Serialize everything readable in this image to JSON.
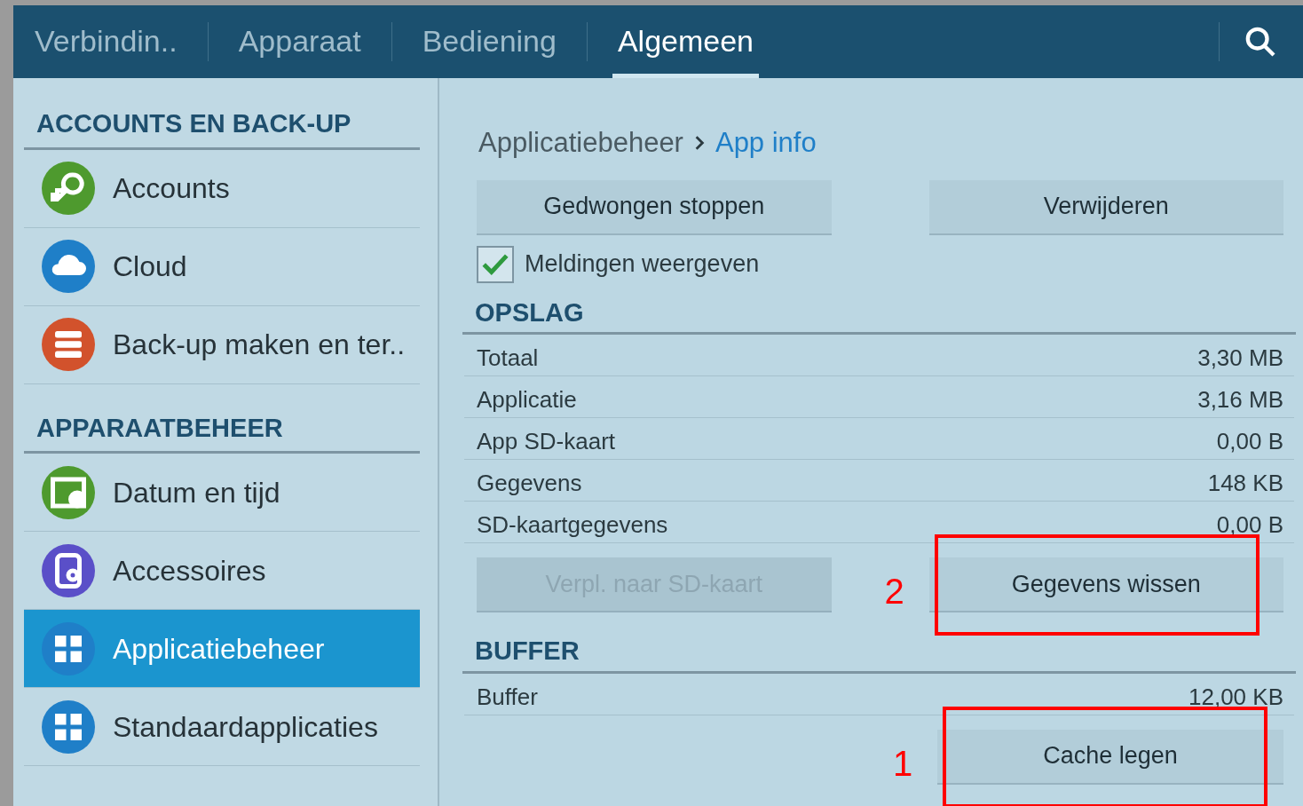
{
  "tabs": [
    {
      "label": "Verbindin..",
      "selected": false
    },
    {
      "label": "Apparaat",
      "selected": false
    },
    {
      "label": "Bediening",
      "selected": false
    },
    {
      "label": "Algemeen",
      "selected": true
    }
  ],
  "sidebar": {
    "sections": [
      {
        "heading": "ACCOUNTS EN BACK-UP",
        "items": [
          {
            "label": "Accounts",
            "kind": "key",
            "color": "#4e9a2e",
            "selected": false
          },
          {
            "label": "Cloud",
            "kind": "cloud",
            "color": "#1f7fc8",
            "selected": false
          },
          {
            "label": "Back-up maken en ter..",
            "kind": "backup",
            "color": "#d2522c",
            "selected": false
          }
        ]
      },
      {
        "heading": "APPARAATBEHEER",
        "items": [
          {
            "label": "Datum en tijd",
            "kind": "calendar",
            "color": "#4e9a2e",
            "selected": false
          },
          {
            "label": "Accessoires",
            "kind": "accessory",
            "color": "#5a4fc8",
            "selected": false
          },
          {
            "label": "Applicatiebeheer",
            "kind": "grid",
            "color": "#1f7fc8",
            "selected": true
          },
          {
            "label": "Standaardapplicaties",
            "kind": "grid",
            "color": "#1f7fc8",
            "selected": false
          }
        ]
      }
    ]
  },
  "breadcrumb": {
    "parent": "Applicatiebeheer",
    "current": "App info"
  },
  "top_buttons": [
    {
      "label": "Gedwongen stoppen",
      "disabled": false
    },
    {
      "label": "Verwijderen",
      "disabled": false
    }
  ],
  "notifications": {
    "label": "Meldingen weergeven",
    "checked": true
  },
  "storage": {
    "heading": "OPSLAG",
    "rows": [
      {
        "label": "Totaal",
        "value": "3,30 MB"
      },
      {
        "label": "Applicatie",
        "value": "3,16 MB"
      },
      {
        "label": "App SD-kaart",
        "value": "0,00 B"
      },
      {
        "label": "Gegevens",
        "value": "148 KB"
      },
      {
        "label": "SD-kaartgegevens",
        "value": "0,00 B"
      }
    ],
    "buttons": [
      {
        "label": "Verpl. naar SD-kaart",
        "disabled": true
      },
      {
        "label": "Gegevens wissen",
        "disabled": false,
        "annotation": "2"
      }
    ]
  },
  "buffer": {
    "heading": "BUFFER",
    "rows": [
      {
        "label": "Buffer",
        "value": "12,00 KB"
      }
    ],
    "buttons": [
      {
        "label": "Cache legen",
        "disabled": false,
        "annotation": "1"
      }
    ]
  }
}
